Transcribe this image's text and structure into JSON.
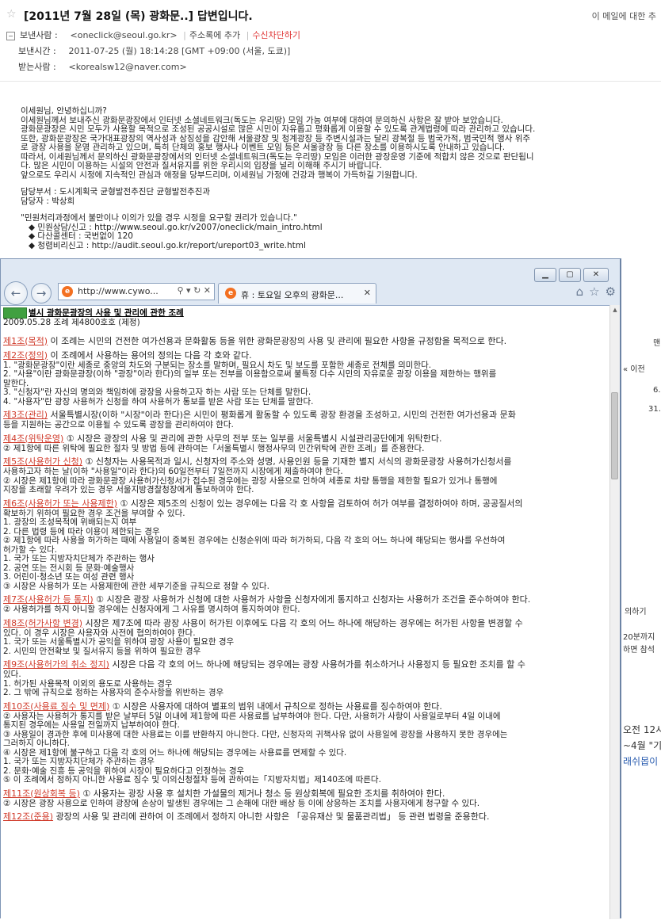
{
  "mail": {
    "subject": "[2011년 7월 28일 (목) 광화문..] 답변입니다.",
    "subject_action": "이 메일에 대한 추",
    "sender_label": "보낸사람 :",
    "sender": "<oneclick@seoul.go.kr>",
    "add_contact": "주소록에 추가",
    "block": "수신차단하기",
    "time_label": "보낸시간 :",
    "time": "2011-07-25 (월) 18:14:28 [GMT +09:00 (서울, 도쿄)]",
    "to_label": "받는사람 :",
    "to": "<korealsw12@naver.com>",
    "body": [
      "이세원님, 안녕하십니까?",
      " 이세원님께서 보내주신 광화문광장에서 인터넷 소셜네트워크(독도는 우리땅) 모임 가능 여부에 대하여 문의하신 사항은 잘 받아 보았습니다.",
      " 광화문광장은 시민 모두가 사용할 목적으로 조성된 공공시설로 많은 시민이 자유롭고 평화롭게 이용할 수 있도록 관계법령에 따라 관리하고 있습니다.",
      " 또한, 광화문광장은 국가대표광장의 역사성과 상징성을 감안해 서울광장 및 청계광장 등 주변시설과는 달리 광복절 등 범국가적, 범국민적 행사 위주",
      "로 광장 사용을 운영 관리하고 있으며, 특히 단체의 홍보 행사나 이벤트 모임 등은 서울광장 등 다른 장소를 이용하시도록 안내하고 있습니다.",
      " 따라서, 이세원님께서 문의하신 광화문광장에서의 인터넷 소셜네트워크(독도는 우리땅) 모임은 이러한 광장운영 기준에 적합치 않은 것으로 판단됩니",
      "다. 많은 시민이 이용하는 시설의 안전과 질서유지를 위한 우리시의 입장을 널리 이해해 주시기 바랍니다.",
      " 앞으로도 우리시 시정에 지속적인 관심과 애정을 당부드리며, 이세원님 가정에 건강과 행복이 가득하길 기원합니다."
    ],
    "dept_label": "담당부서 : 도시계획국 균형발전추진단 균형발전추진과",
    "person_label": "담당자 : 박상희",
    "rights": "\"민원처리과정에서 불만이나 이의가 있을 경우 시정을 요구할 권리가 있습니다.\"",
    "bullets": [
      "◆ 민원상담/신고 : http://www.seoul.go.kr/v2007/oneclick/main_intro.html",
      "◆ 다산콜센터 : 국번없이 120",
      "◆ 청렴비리신고 : http://audit.seoul.go.kr/report/ureport03_write.html"
    ],
    "side": [
      "맨",
      "« 이전",
      "6.",
      "31.",
      "의하기",
      "20분까지",
      "하면 참석",
      "오전 12시",
      "~4월 \"기",
      "래쉬몹이"
    ]
  },
  "browser": {
    "address": "http://www.cywo...",
    "tab_title": "휴 : 토요일 오후의 광화문...",
    "title_icon": "",
    "doc_title": "별시 광화문광장의 사용 및 관리에 관한 조례",
    "doc_sub": "2009.05.28 조례 제4800호호 (제정)",
    "articles": [
      {
        "title": "제1조(목적)",
        "lines": [
          " 이 조례는 시민의 건전한 여가선용과 문화활동 등을 위한 광화문광장의 사용 및 관리에 필요한 사항을 규정함을 목적으로 한다."
        ]
      },
      {
        "title": "제2조(정의)",
        "lines": [
          " 이 조례에서 사용하는 용어의 정의는 다음 각 호와 같다.",
          "1. \"광화문광장\"이란 세종로 중앙의 차도와 구분되는 장소를 말하며, 필요시 차도 및 보도를 포함한 세종로 전체를 의미한다.",
          "2. \"사용\"이란 광화문광장(이하 \"광장\"이라 한다)의 일부 또는 전부를 이용함으로써 불특정 다수 시민의 자유로운 광장 이용을 제한하는 행위를",
          "말한다.",
          "3. \"신청자\"란 자신의 명의와 책임하에 광장을 사용하고자 하는 사람 또는 단체를 말한다.",
          "4. \"사용자\"란 광장 사용허가 신청을 하여 사용허가 통보를 받은 사람 또는 단체를 말한다."
        ]
      },
      {
        "title": "제3조(관리)",
        "lines": [
          " 서울특별시장(이하 \"시장\"이라 한다)은 시민이 평화롭게 활동할 수 있도록 광장 환경을 조성하고, 시민의 건전한 여가선용과 문화",
          "등을 지원하는 공간으로 이용될 수 있도록 광장을 관리하여야 한다."
        ]
      },
      {
        "title": "제4조(위탁운영)",
        "lines": [
          " ① 시장은 광장의 사용 및 관리에 관한 사무의 전부 또는 일부를 서울특별시 시설관리공단에게 위탁한다.",
          "② 제1항에 따른 위탁에 필요한 절차 및 방법 등에 관하여는「서울특별시 행정사무의 민간위탁에 관한 조례」를 준용한다."
        ]
      },
      {
        "title": "제5조(사용허가 신청)",
        "lines": [
          " ① 신청자는 사용목적과 일시, 신청자의 주소와 성명, 사용인원 등을 기재한 별지 서식의 광화문광장 사용허가신청서를",
          "사용하고자 하는 날(이하 \"사용일\"이라 한다)의 60일전부터 7일전까지 시장에게 제출하여야 한다.",
          "② 시장은 제1항에 따라 광화문광장 사용허가신청서가 접수된 경우에는 광장 사용으로 인하여 세종로 차량 통행을 제한할 필요가 있거나 통행에",
          "지장을 초래할 우려가 있는 경우 서울지방경찰청장에게 통보하여야 한다."
        ]
      },
      {
        "title": "제6조(사용허가 또는 사용제한)",
        "lines": [
          " ① 시장은 제5조의 신청이 있는 경우에는 다음 각 호 사항을 검토하여 허가 여부를 결정하여야 하며, 공공질서의",
          "확보하기 위하여 필요한 경우 조건을 부여할 수 있다.",
          "1. 광장의 조성목적에 위배되는지 여부",
          "2. 다른 법령 등에 따라 이용이 제한되는 경우",
          "② 제1항에 따라 사용을 허가하는 때에 사용일이 중복된 경우에는 신청순위에 따라 허가하되, 다음 각 호의 어느 하나에 해당되는 행사를 우선하여",
          "허가할 수 있다.",
          "1. 국가 또는 지방자치단체가 주관하는 행사",
          "2. 공연 또는 전시회 등 문화·예술행사",
          "3. 어린이·청소년 또는 여성 관련 행사",
          "③ 시장은 사용허가 또는 사용제한에 관한 세부기준을 규칙으로 정할 수 있다."
        ]
      },
      {
        "title": "제7조(사용허가 등 통지)",
        "lines": [
          " ① 시장은 광장 사용허가 신청에 대한 사용허가 사항을 신청자에게 통지하고 신청자는 사용허가 조건을 준수하여야 한다.",
          "② 사용허가를 하지 아니할 경우에는 신청자에게 그 사유를 명시하여 통지하여야 한다."
        ]
      },
      {
        "title": "제8조(허가사항 변경)",
        "lines": [
          " 시장은 제7조에 따라 광장 사용이 허가된 이후에도 다음 각 호의 어느 하나에 해당하는 경우에는 허가된 사항을 변경할 수",
          "있다. 이 경우 시장은 사용자와 사전에 협의하여야 한다.",
          "1. 국가 또는 서울특별시가 공익을 위하여 광장 사용이 필요한 경우",
          "2. 시민의 안전확보 및 질서유지 등을 위하여 필요한 경우"
        ]
      },
      {
        "title": "제9조(사용허가의 취소 정지)",
        "lines": [
          " 시장은 다음 각 호의 어느 하나에 해당되는 경우에는 광장 사용허가를 취소하거나 사용정지 등 필요한 조치를 할 수",
          "있다.",
          "1. 허가된 사용목적 이외의 용도로 사용하는 경우",
          "2. 그 밖에 규칙으로 정하는 사용자의 준수사항을 위반하는 경우"
        ]
      },
      {
        "title": "제10조(사용료 징수 및 면제)",
        "lines": [
          " ① 시장은 사용자에 대하여 별표의 범위 내에서 규칙으로 정하는 사용료를 징수하여야 한다.",
          "② 사용자는 사용허가 통지를 받은 날부터 5일 이내에 제1항에 따른 사용료를 납부하여야 한다. 다만, 사용허가 사항이 사용일로부터 4일 이내에",
          "통지된 경우에는 사용일 전일까지 납부하여야 한다.",
          "③ 사용일이 경과한 후에 미사용에 대한 사용료는 이를 반환하지 아니한다. 다만, 신청자의 귀책사유 없이 사용일에 광장을 사용하지 못한 경우에는",
          "그러하지 아니하다.",
          "④ 시장은 제1항에 불구하고 다음 각 호의 어느 하나에 해당되는 경우에는 사용료를 면제할 수 있다.",
          "1. 국가 또는 지방자치단체가 주관하는 경우",
          "2. 문화·예술 진흥 등 공익을 위하여 시장이 필요하다고 인정하는 경우",
          "⑤ 이 조례에서 정하지 아니한 사용료 징수 및 이의신청절차 등에 관하여는「지방자치법」제140조에 따른다."
        ]
      },
      {
        "title": "제11조(원상회복 등)",
        "lines": [
          " ① 사용자는 광장 사용 후 설치한 가설물의 제거나 청소 등 원상회복에 필요한 조치를 취하여야 한다.",
          "② 시장은 광장 사용으로 인하여 광장에 손상이 발생된 경우에는 그 손해에 대한 배상 등 이에 상응하는 조치를 사용자에게 청구할 수 있다."
        ]
      },
      {
        "title": "제12조(준용)",
        "lines": [
          " 광장의 사용 및 관리에 관하여 이 조례에서 정하지 아니한 사항은 「공유재산 및 물품관리법」 등 관련 법령을 준용한다."
        ]
      }
    ]
  },
  "colors": {
    "article_title": "#d03a2a",
    "block_link": "#e03a3a",
    "window_frame": "#dfe8f3"
  }
}
